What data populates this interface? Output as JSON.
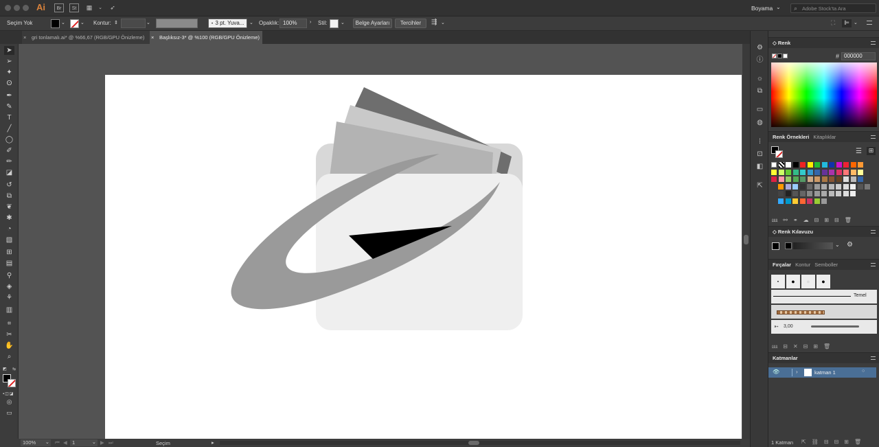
{
  "app": {
    "logo": "Ai",
    "workspace": "Boyama",
    "search_placeholder": "Adobe Stock'ta Ara"
  },
  "control_bar": {
    "selection_status": "Seçim Yok",
    "stroke_label": "Kontur:",
    "brush_value": "3 pt. Yuva...",
    "opacity_label": "Opaklık:",
    "opacity_value": "100%",
    "style_label": "Stil:",
    "doc_setup_button": "Belge Ayarları",
    "prefs_button": "Tercihler"
  },
  "tabs": [
    {
      "label": "gri tonlamalı.ai* @ %66,67 (RGB/GPU Önizleme)",
      "active": false
    },
    {
      "label": "Başlıksız-3* @ %100 (RGB/GPU Önizleme)",
      "active": true
    }
  ],
  "status_bar": {
    "zoom": "100%",
    "page": "1",
    "tool": "Seçim"
  },
  "panels": {
    "color": {
      "title": "Renk",
      "hex": "000000"
    },
    "swatches": {
      "title": "Renk Örnekleri",
      "tab2": "Kitaplıklar"
    },
    "color_guide": {
      "title": "Renk Kılavuzu"
    },
    "brushes": {
      "title": "Fırçalar",
      "tab2": "Kontur",
      "tab3": "Semboller",
      "basic_label": "Temel",
      "size_label": "3,00"
    },
    "layers": {
      "title": "Katmanlar",
      "layer_name": "katman 1",
      "count": "1 Katman"
    }
  },
  "colors": {
    "accent": "#4a6f96",
    "artboard": "#ffffff",
    "canvas": "#535353"
  }
}
